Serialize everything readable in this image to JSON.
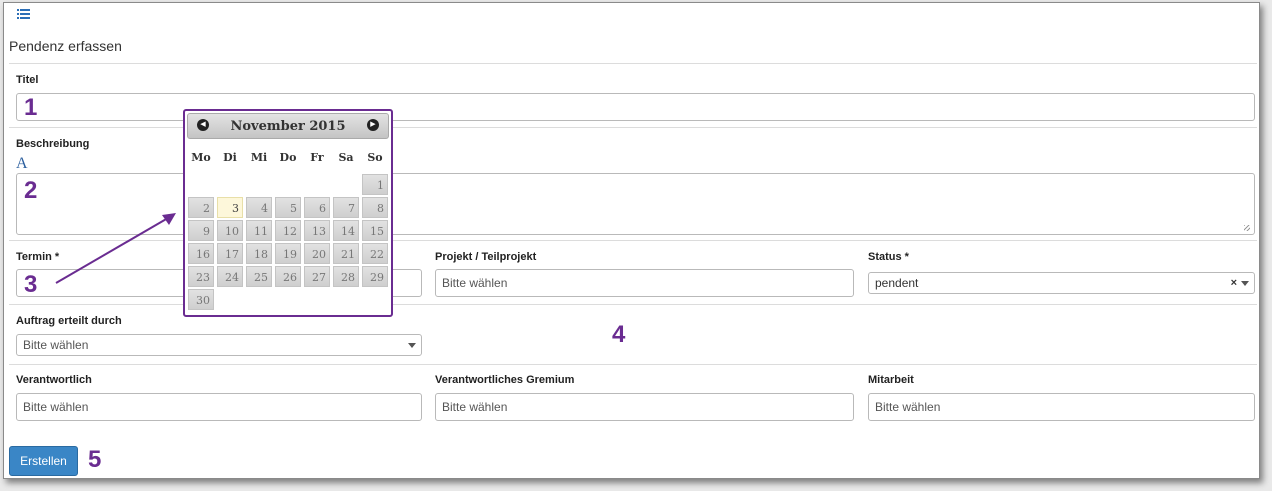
{
  "form": {
    "title": "Pendenz erfassen",
    "titel_label": "Titel",
    "beschreibung_label": "Beschreibung",
    "font_icon_glyph": "A",
    "termin_label": "Termin *",
    "projekt_label": "Projekt / Teilprojekt",
    "projekt_placeholder": "Bitte wählen",
    "status_label": "Status *",
    "status_value": "pendent",
    "status_clear": "×",
    "auftrag_label": "Auftrag erteilt durch",
    "auftrag_placeholder": "Bitte wählen",
    "verantwortlich_label": "Verantwortlich",
    "verantwortlich_placeholder": "Bitte wählen",
    "gremium_label": "Verantwortliches Gremium",
    "gremium_placeholder": "Bitte wählen",
    "mitarbeit_label": "Mitarbeit",
    "mitarbeit_placeholder": "Bitte wählen",
    "submit_label": "Erstellen"
  },
  "annotations": [
    "1",
    "2",
    "3",
    "4",
    "5"
  ],
  "annotation_color": "#6a2c91",
  "datepicker": {
    "month_label": "November 2015",
    "prev_icon": "◀",
    "next_icon": "▶",
    "weekdays": [
      "Mo",
      "Di",
      "Mi",
      "Do",
      "Fr",
      "Sa",
      "So"
    ],
    "today": "3",
    "days": [
      "1",
      "2",
      "3",
      "4",
      "5",
      "6",
      "7",
      "8",
      "9",
      "10",
      "11",
      "12",
      "13",
      "14",
      "15",
      "16",
      "17",
      "18",
      "19",
      "20",
      "21",
      "22",
      "23",
      "24",
      "25",
      "26",
      "27",
      "28",
      "29",
      "30"
    ]
  },
  "icons": {
    "top_left": "list-icon",
    "datepicker_prev": "circle-arrow-left-icon",
    "datepicker_next": "circle-arrow-right-icon",
    "dropdown": "caret-down-icon"
  },
  "colors": {
    "button_bg": "#3a86c6",
    "datepicker_border": "#6a2c91",
    "today_bg": "#fdf7da"
  }
}
